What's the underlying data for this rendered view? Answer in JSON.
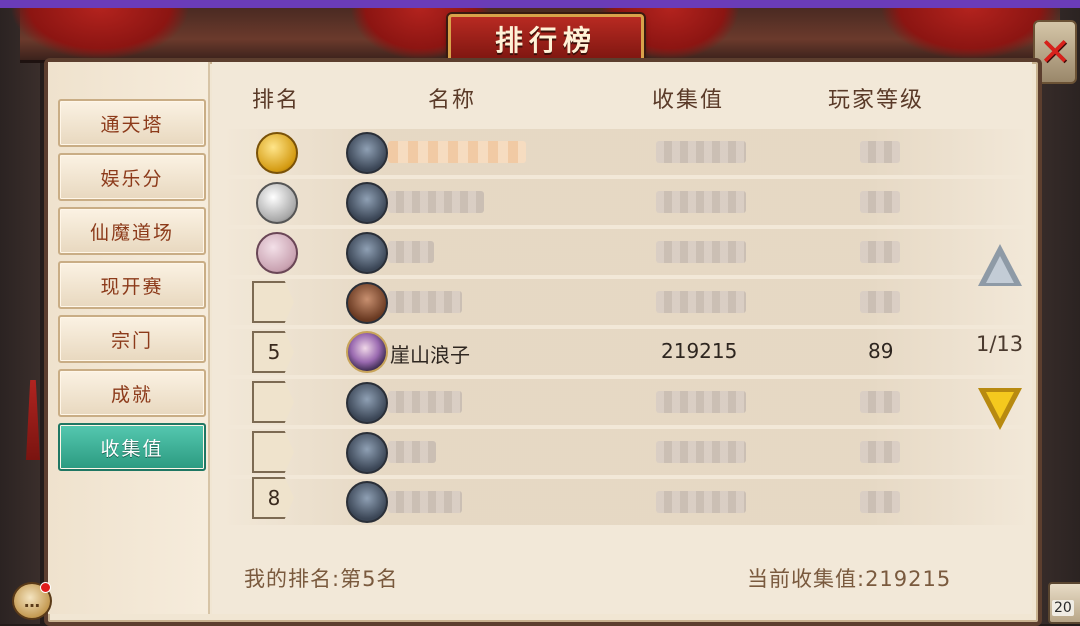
{
  "window": {
    "title": "排行榜",
    "close_icon": "close-x-icon"
  },
  "sidebar": {
    "items": [
      {
        "label": "通天塔",
        "active": false
      },
      {
        "label": "娱乐分",
        "active": false
      },
      {
        "label": "仙魔道场",
        "active": false
      },
      {
        "label": "现开赛",
        "active": false
      },
      {
        "label": "宗门",
        "active": false
      },
      {
        "label": "成就",
        "active": false
      },
      {
        "label": "收集值",
        "active": true
      }
    ]
  },
  "table": {
    "headers": {
      "rank": "排名",
      "name": "名称",
      "value": "收集值",
      "level": "玩家等级"
    },
    "rows": [
      {
        "rank": "1",
        "rank_icon": "gold-medal-icon",
        "name": "",
        "value": "",
        "level": "",
        "blurred": true
      },
      {
        "rank": "2",
        "rank_icon": "silver-medal-icon",
        "name": "",
        "value": "",
        "level": "",
        "blurred": true
      },
      {
        "rank": "3",
        "rank_icon": "bronze-medal-icon",
        "name": "",
        "value": "",
        "level": "",
        "blurred": true
      },
      {
        "rank": "",
        "rank_icon": "rank-tag-icon",
        "name": "",
        "value": "",
        "level": "",
        "blurred": true
      },
      {
        "rank": "5",
        "rank_icon": "rank-tag-icon",
        "name": "崖山浪子",
        "value": "219215",
        "level": "89",
        "blurred": false
      },
      {
        "rank": "",
        "rank_icon": "rank-tag-icon",
        "name": "",
        "value": "",
        "level": "",
        "blurred": true
      },
      {
        "rank": "",
        "rank_icon": "rank-tag-icon",
        "name": "",
        "value": "",
        "level": "",
        "blurred": true
      },
      {
        "rank": "8",
        "rank_icon": "rank-tag-icon",
        "name": "",
        "value": "",
        "level": "",
        "blurred": true
      }
    ]
  },
  "pagination": {
    "page_text": "1/13",
    "up_icon": "arrow-up-icon",
    "down_icon": "arrow-down-icon"
  },
  "footer": {
    "my_rank": "我的排名:第5名",
    "current_value": "当前收集值:219215"
  },
  "overlay": {
    "chat_icon": "chat-bubble-icon",
    "online_count": "20"
  },
  "colors": {
    "active_tab": "#2b9a80",
    "title_plate": "#b82a22",
    "panel_bg": "#f1e6d3"
  }
}
